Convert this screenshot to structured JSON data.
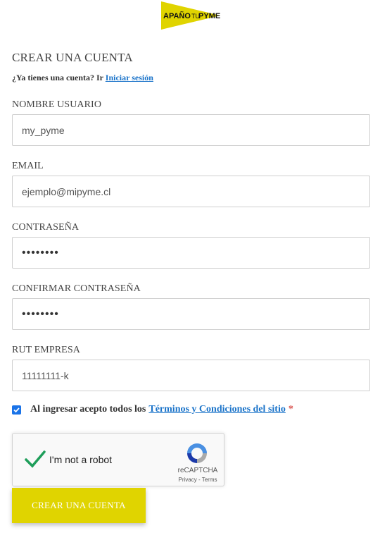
{
  "brand": {
    "logo_text_1": "APAÑO",
    "logo_text_2": "TU",
    "logo_text_3": "PYME",
    "accent_color": "#e0d400"
  },
  "form": {
    "title": "CREAR UNA CUENTA",
    "login_prompt": "¿Ya tienes una cuenta? Ir",
    "login_link": "Iniciar sesión",
    "fields": [
      {
        "label": "NOMBRE USUARIO",
        "value": "my_pyme"
      },
      {
        "label": "EMAIL",
        "value": "ejemplo@mipyme.cl"
      },
      {
        "label": "CONTRASEÑA",
        "value": "••••••••"
      },
      {
        "label": "CONFIRMAR CONTRASEÑA",
        "value": "••••••••"
      },
      {
        "label": "RUT EMPRESA",
        "value": "11111111-k"
      }
    ],
    "terms_text": "Al ingresar acepto todos los",
    "terms_link": "Términos y Condiciones del sitio",
    "required_mark": "*",
    "terms_checked": true,
    "submit_label": "CREAR UNA CUENTA"
  },
  "captcha": {
    "label": "I'm not a robot",
    "brand": "reCAPTCHA",
    "privacy": "Privacy",
    "separator": " - ",
    "terms": "Terms",
    "checked": true
  }
}
